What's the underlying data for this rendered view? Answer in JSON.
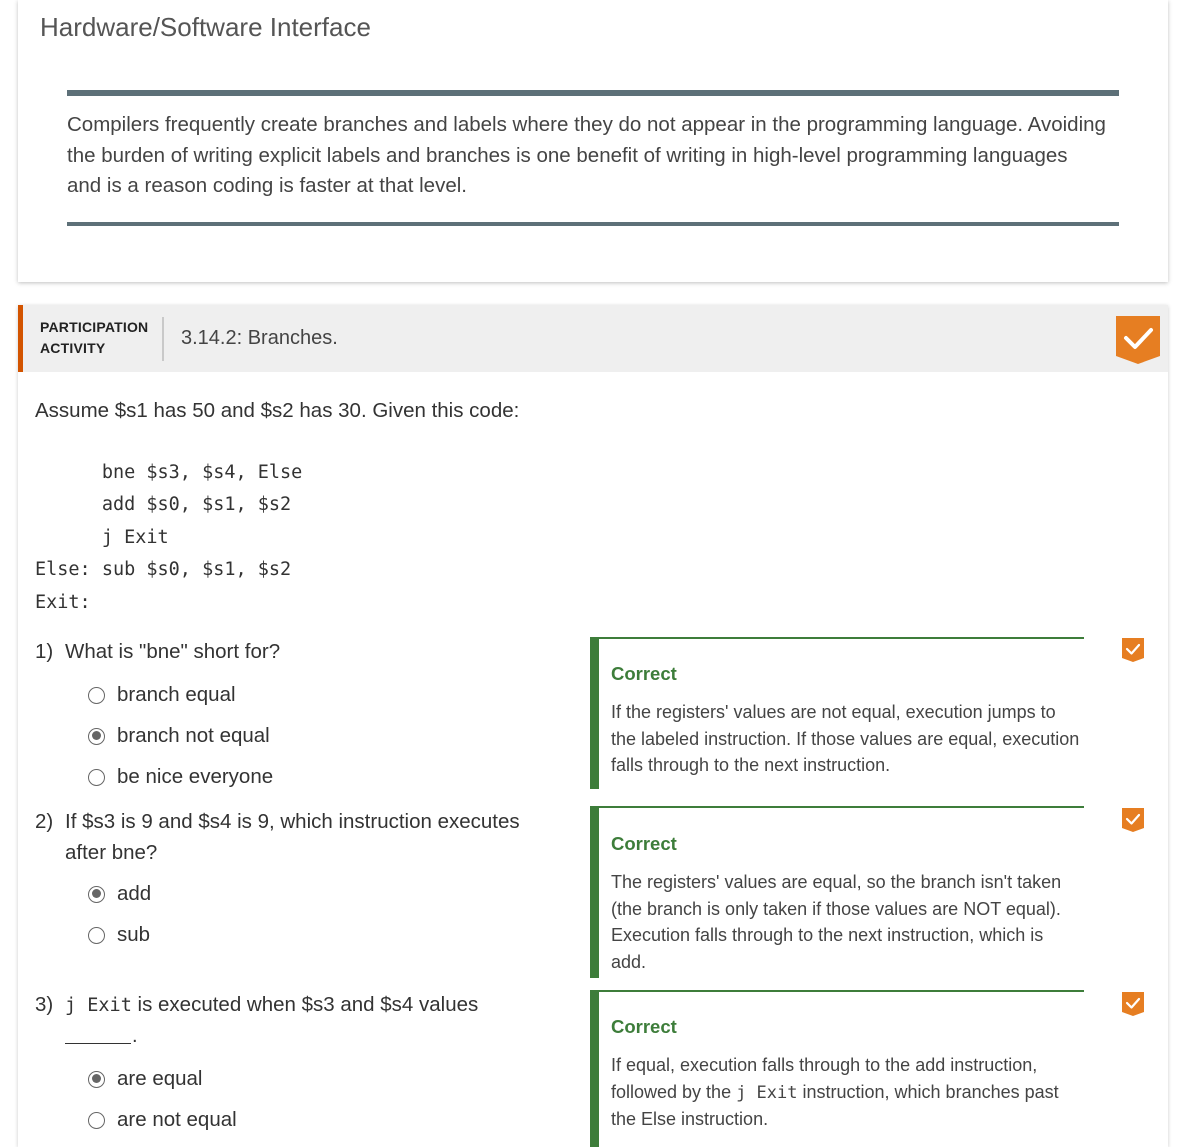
{
  "section": {
    "title": "Hardware/Software Interface",
    "text": "Compilers frequently create branches and labels where they do not appear in the programming language. Avoiding the burden of writing explicit labels and branches is one benefit of writing in high-level programming languages and is a reason coding is faster at that level."
  },
  "activity": {
    "label_line1": "PARTICIPATION",
    "label_line2": "ACTIVITY",
    "title": "3.14.2: Branches.",
    "intro": "Assume $s1 has 50 and $s2 has 30. Given this code:",
    "code_lines": [
      "      bne $s3, $s4, Else",
      "      add $s0, $s1, $s2",
      "      j Exit",
      "Else: sub $s0, $s1, $s2",
      "Exit:"
    ],
    "accent_color": "#d35400",
    "check_color": "#e67e22"
  },
  "questions": [
    {
      "number": "1)",
      "text": "What is \"bne\" short for?",
      "options": [
        {
          "label": "branch equal",
          "selected": false
        },
        {
          "label": "branch not equal",
          "selected": true
        },
        {
          "label": "be nice everyone",
          "selected": false
        }
      ],
      "feedback": {
        "status": "Correct",
        "explanation": "If the registers' values are not equal, execution jumps to the labeled instruction. If those values are equal, execution falls through to the next instruction."
      }
    },
    {
      "number": "2)",
      "text_line1": "If $s3 is 9 and $s4 is 9, which instruction executes",
      "text_line2": "after bne?",
      "options": [
        {
          "label": "add",
          "selected": true
        },
        {
          "label": "sub",
          "selected": false
        }
      ],
      "feedback": {
        "status": "Correct",
        "explanation": "The registers' values are equal, so the branch isn't taken (the branch is only taken if those values are NOT equal). Execution falls through to the next instruction, which is add."
      }
    },
    {
      "number": "3)",
      "code": "j Exit",
      "text_after": " is executed when $s3 and $s4 values",
      "blank_suffix": ".",
      "options": [
        {
          "label": "are equal",
          "selected": true
        },
        {
          "label": "are not equal",
          "selected": false
        }
      ],
      "feedback": {
        "status": "Correct",
        "explanation_before": "If equal, execution falls through to the add instruction, followed by the ",
        "explanation_code": "j Exit",
        "explanation_after": " instruction, which branches past the Else instruction."
      }
    }
  ],
  "colors": {
    "correct": "#3d7d3a",
    "rule": "#5d7078"
  }
}
